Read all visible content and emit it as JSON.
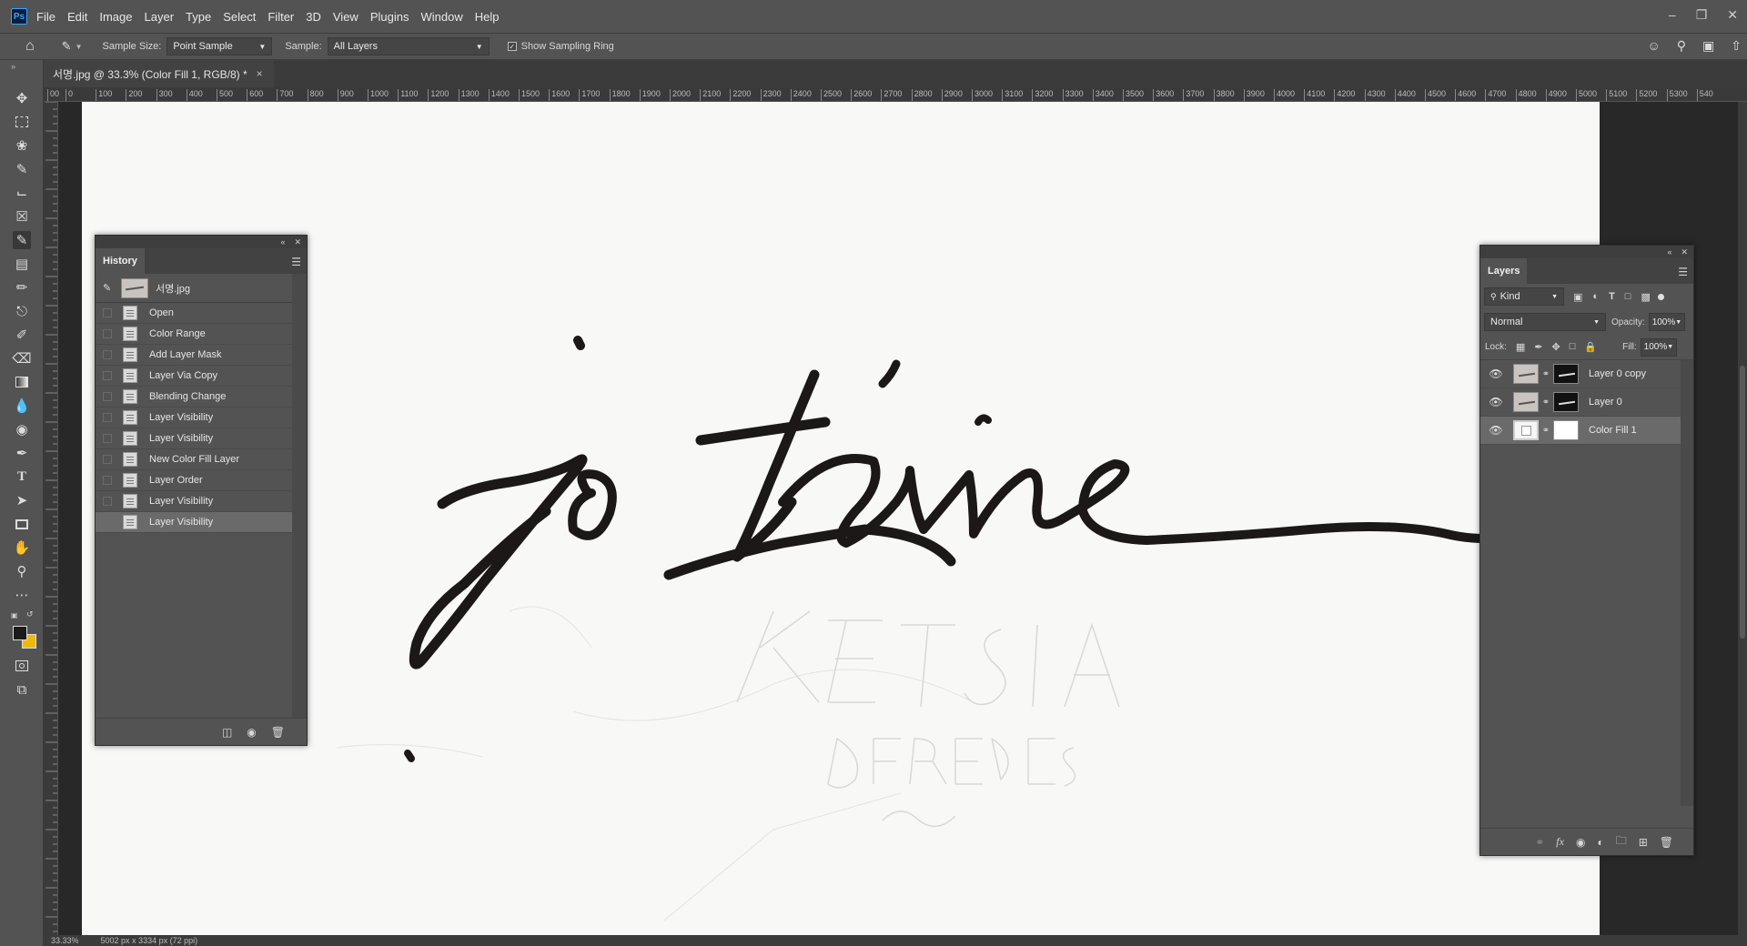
{
  "app": {
    "logo": "Ps",
    "menu": [
      "File",
      "Edit",
      "Image",
      "Layer",
      "Type",
      "Select",
      "Filter",
      "3D",
      "View",
      "Plugins",
      "Window",
      "Help"
    ],
    "window_controls": [
      "minimize-icon",
      "restore-icon",
      "close-icon"
    ]
  },
  "options": {
    "sample_size_label": "Sample Size:",
    "sample_size_value": "Point Sample",
    "sample_label": "Sample:",
    "sample_value": "All Layers",
    "show_ring_label": "Show Sampling Ring",
    "show_ring_checked": true
  },
  "document": {
    "tab_title": "서명.jpg @ 33.3% (Color Fill 1, RGB/8) *",
    "close_glyph": "×"
  },
  "ruler": {
    "top_ticks": [
      "00",
      "0",
      "100",
      "200",
      "300",
      "400",
      "500",
      "600",
      "700",
      "800",
      "900",
      "1000",
      "1100",
      "1200",
      "1300",
      "1400",
      "1500",
      "1600",
      "1700",
      "1800",
      "1900",
      "2000",
      "2100",
      "2200",
      "2300",
      "2400",
      "2500",
      "2600",
      "2700",
      "2800",
      "2900",
      "3000",
      "3100",
      "3200",
      "3300",
      "3400",
      "3500",
      "3600",
      "3700",
      "3800",
      "3900",
      "4000",
      "4100",
      "4200",
      "4300",
      "4400",
      "4500",
      "4600",
      "4700",
      "4800",
      "4900",
      "5000",
      "5100",
      "5200",
      "5300",
      "540"
    ]
  },
  "status": {
    "zoom": "33.33%",
    "dimensions": "5002 px x 3334 px (72 ppi)"
  },
  "colors": {
    "foreground": "#1a1a1a",
    "background": "#f0b800",
    "canvas": "#f8f8f7",
    "ink": "#1b1817"
  },
  "history": {
    "title": "History",
    "snapshot_name": "서명.jpg",
    "items": [
      "Open",
      "Color Range",
      "Add Layer Mask",
      "Layer Via Copy",
      "Blending Change",
      "Layer Visibility",
      "Layer Visibility",
      "New Color Fill Layer",
      "Layer Order",
      "Layer Visibility",
      "Layer Visibility"
    ],
    "selected_index": 10
  },
  "layers": {
    "title": "Layers",
    "filter_kind": "Kind",
    "blend_mode": "Normal",
    "opacity_label": "Opacity:",
    "opacity_value": "100%",
    "lock_label": "Lock:",
    "fill_label": "Fill:",
    "fill_value": "100%",
    "items": [
      {
        "name": "Layer 0 copy",
        "visible": true,
        "selected": false
      },
      {
        "name": "Layer 0",
        "visible": true,
        "selected": false
      },
      {
        "name": "Color Fill 1",
        "visible": true,
        "selected": true
      }
    ]
  }
}
